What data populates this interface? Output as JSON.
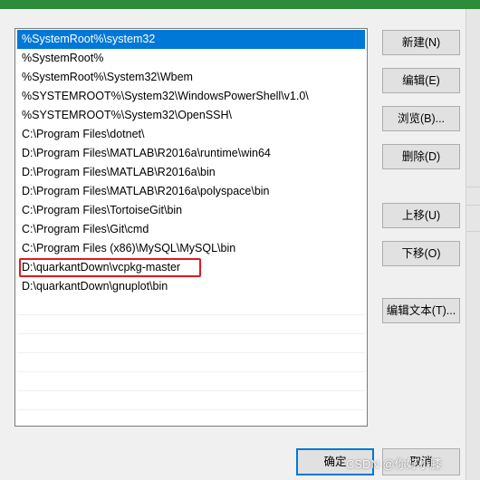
{
  "path_entries": [
    "%SystemRoot%\\system32",
    "%SystemRoot%",
    "%SystemRoot%\\System32\\Wbem",
    "%SYSTEMROOT%\\System32\\WindowsPowerShell\\v1.0\\",
    "%SYSTEMROOT%\\System32\\OpenSSH\\",
    "C:\\Program Files\\dotnet\\",
    "D:\\Program Files\\MATLAB\\R2016a\\runtime\\win64",
    "D:\\Program Files\\MATLAB\\R2016a\\bin",
    "D:\\Program Files\\MATLAB\\R2016a\\polyspace\\bin",
    "C:\\Program Files\\TortoiseGit\\bin",
    "C:\\Program Files\\Git\\cmd",
    "C:\\Program Files (x86)\\MySQL\\MySQL\\bin",
    "D:\\quarkantDown\\vcpkg-master",
    "D:\\quarkantDown\\gnuplot\\bin"
  ],
  "selected_entry": "%SystemRoot%\\system32",
  "highlighted_entry": "D:\\quarkantDown\\vcpkg-master",
  "buttons": {
    "new": "新建(N)",
    "edit": "编辑(E)",
    "browse": "浏览(B)...",
    "delete": "删除(D)",
    "move_up": "上移(U)",
    "move_down": "下移(O)",
    "edit_text": "编辑文本(T)...",
    "ok": "确定",
    "cancel": "取消"
  },
  "watermark": "CSDN @你好小膝",
  "colors": {
    "title_bar": "#2e8b3a",
    "selection": "#0078d7",
    "highlight_box": "#e0191e"
  }
}
